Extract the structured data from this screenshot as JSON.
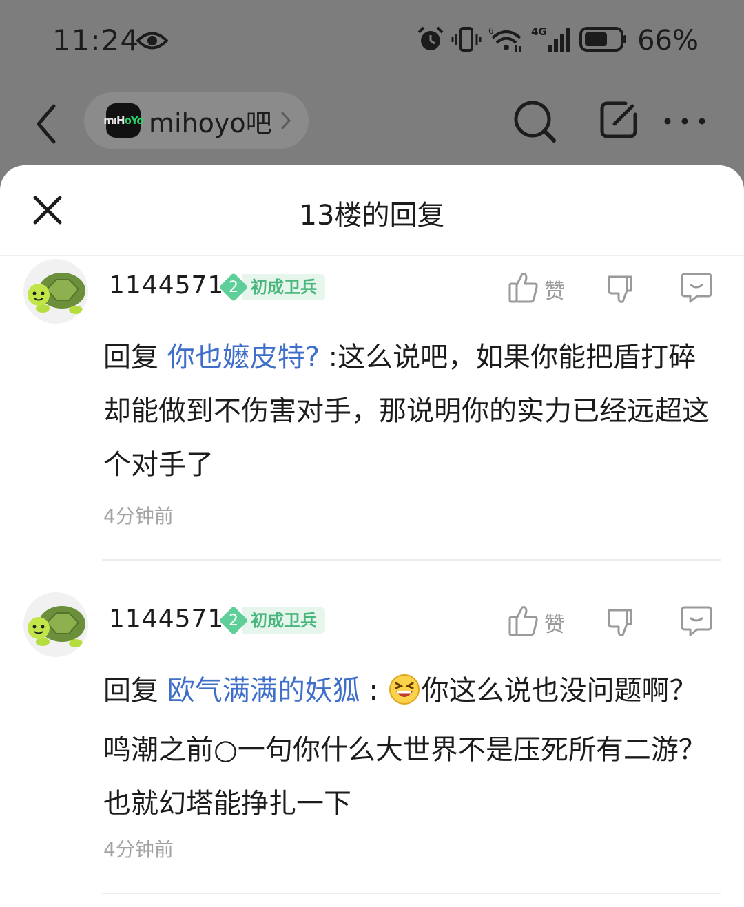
{
  "status_bar": {
    "time": "11:24",
    "battery_percent": "66%",
    "battery_level": 0.66,
    "network": "4G",
    "wifi_badge": "6",
    "icons": [
      "eye-icon",
      "alarm-icon",
      "vibrate-icon",
      "wifi-icon",
      "signal-icon",
      "battery-icon"
    ]
  },
  "nav": {
    "forum_name": "mihoyo吧",
    "forum_logo_text_a": "mıH",
    "forum_logo_text_b": "oYo"
  },
  "sheet": {
    "title": "13楼的回复"
  },
  "comments": [
    {
      "username": "1144571",
      "level": "2",
      "level_title": "初成卫兵",
      "like_label": "赞",
      "reply_prefix": "回复",
      "mention": "你也嬷皮特?",
      "text": " :这么说吧，如果你能把盾打碎却能做到不伤害对手，那说明你的实力已经远超这个对手了",
      "time": "4分钟前"
    },
    {
      "username": "1144571",
      "level": "2",
      "level_title": "初成卫兵",
      "like_label": "赞",
      "reply_prefix": "回复",
      "mention": "欧气满满的妖狐",
      "text_before_emoji": " :",
      "text": "你这么说也没问题啊？鸣潮之前○一句你什么大世界不是压死所有二游？也就幻塔能挣扎一下",
      "time": "4分钟前"
    }
  ],
  "colors": {
    "dim_overlay": "#7d7d7d",
    "mention": "#3f6fc8",
    "level_badge": "#5fcf9a",
    "level_title_bg": "#e6f6ec",
    "level_title_fg": "#49b67d"
  }
}
